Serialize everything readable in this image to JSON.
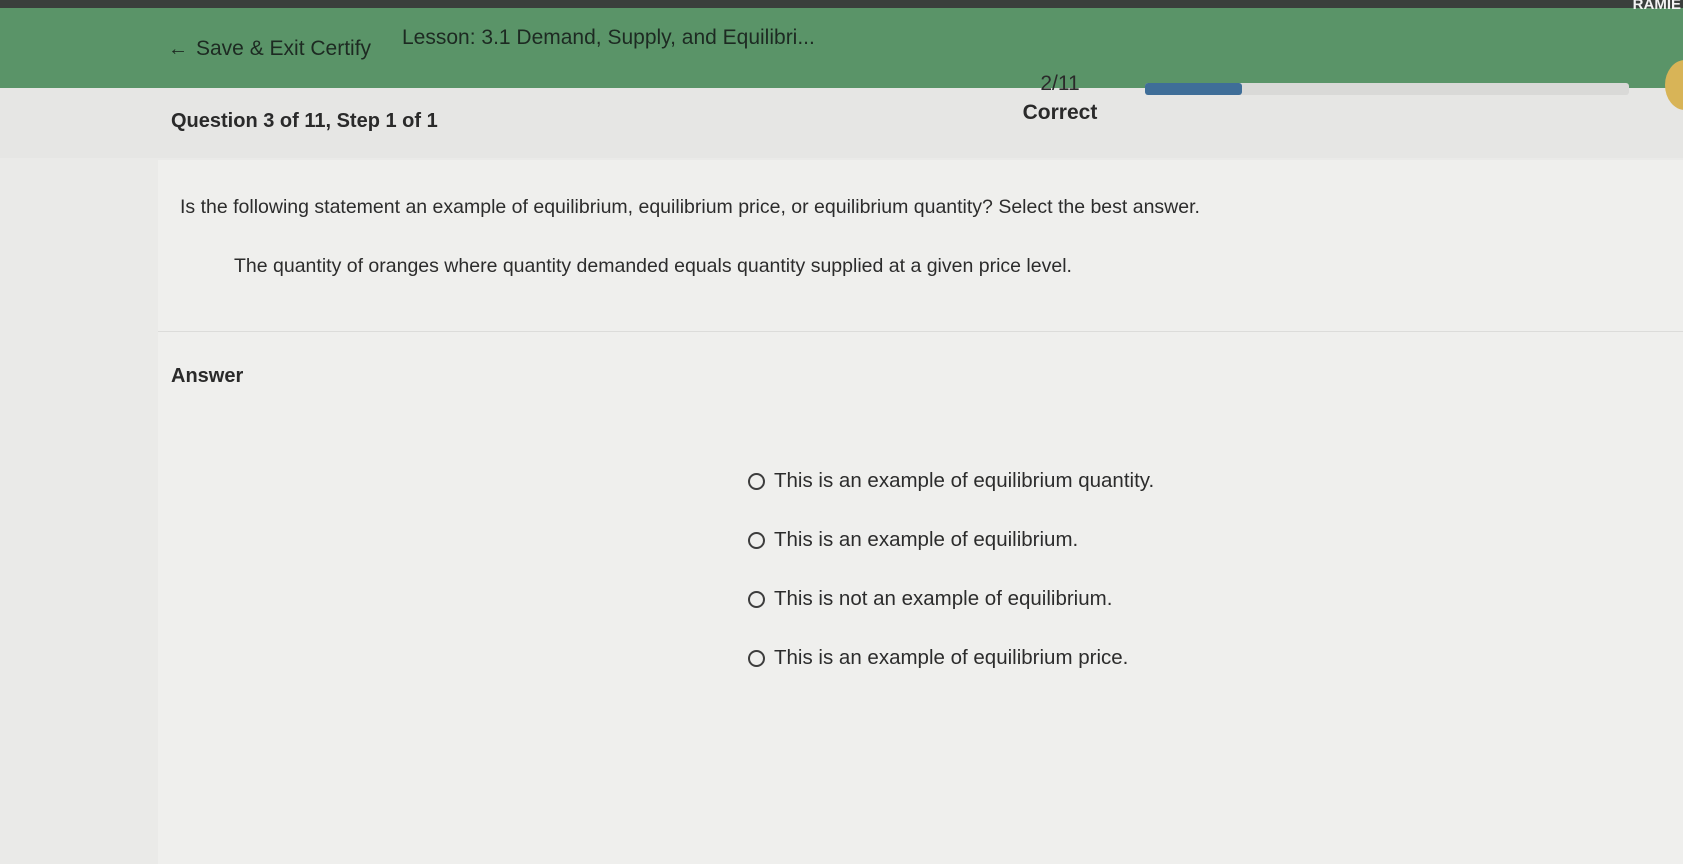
{
  "header": {
    "back_label": "Save & Exit Certify",
    "lesson_title": "Lesson: 3.1 Demand, Supply, and Equilibri...",
    "user_name": "RAMIE"
  },
  "question": {
    "label": "Question 3 of 11, Step 1 of 1",
    "prompt": "Is the following statement an example of equilibrium, equilibrium price, or equilibrium quantity? Select the best answer.",
    "statement": "The quantity of oranges where quantity demanded equals quantity supplied at a given price level."
  },
  "progress": {
    "count": "2/11",
    "status": "Correct",
    "fraction": 0.2
  },
  "answer": {
    "label": "Answer",
    "options": [
      "This is an example of equilibrium quantity.",
      "This is an example of equilibrium.",
      "This is not an example of equilibrium.",
      "This is an example of equilibrium price."
    ]
  },
  "colors": {
    "topbar": "#5a9468",
    "progress_fill": "#3f6e98"
  },
  "icons": {
    "back": "arrow-left-icon",
    "option": "radio-icon"
  }
}
